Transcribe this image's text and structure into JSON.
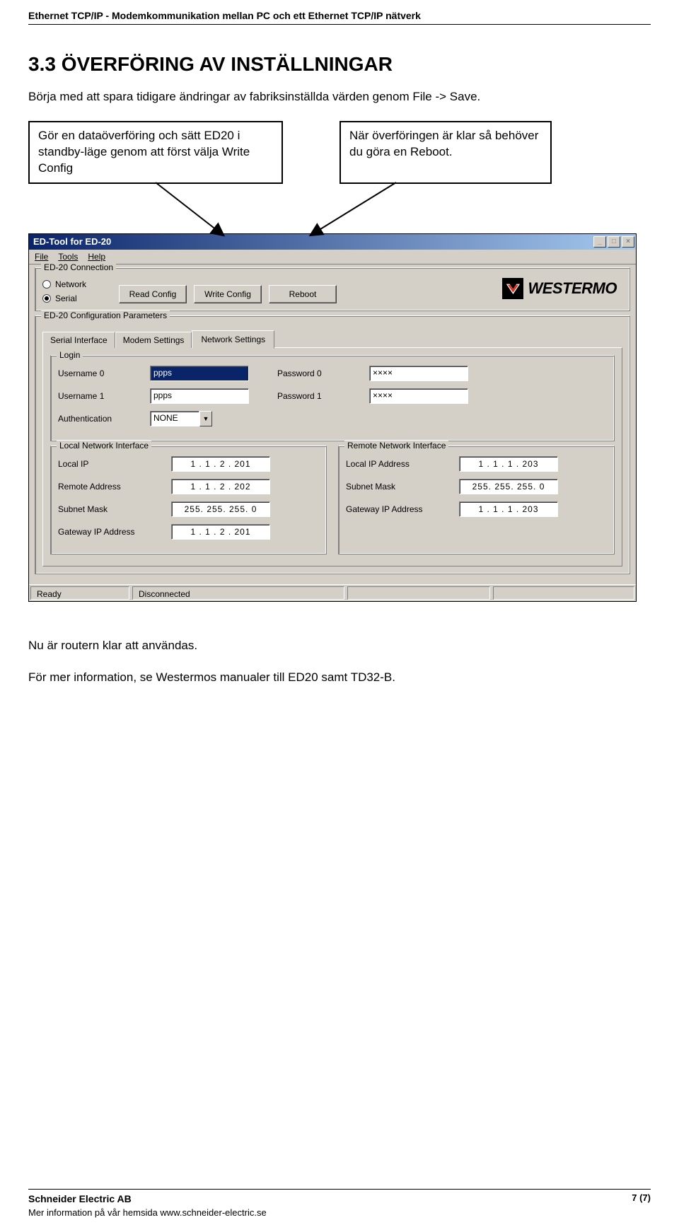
{
  "header": {
    "title": "Ethernet TCP/IP - Modemkommunikation mellan PC och ett Ethernet TCP/IP nätverk"
  },
  "section": {
    "number_title": "3.3   ÖVERFÖRING AV INSTÄLLNINGAR",
    "para1": "Börja med att spara tidigare ändringar av fabriksinställda värden genom File -> Save.",
    "callout_left": "Gör en dataöverföring och sätt ED20 i standby-läge genom att först välja Write Config",
    "callout_right": "När överföringen är klar så behöver du göra en Reboot.",
    "closing1": "Nu är routern klar att användas.",
    "closing2": "För mer information, se Westermos manualer till ED20 samt TD32-B."
  },
  "window": {
    "title": "ED-Tool for ED-20",
    "menubar": [
      "File",
      "Tools",
      "Help"
    ],
    "group_conn": "ED-20 Connection",
    "radios": {
      "network": "Network",
      "serial": "Serial"
    },
    "buttons": {
      "read": "Read Config",
      "write": "Write Config",
      "reboot": "Reboot"
    },
    "logo_text": "WESTERMO",
    "group_params": "ED-20 Configuration Parameters",
    "tabs": [
      "Serial Interface",
      "Modem Settings",
      "Network Settings"
    ],
    "login": {
      "group": "Login",
      "u0_label": "Username 0",
      "u0_value": "ppps",
      "p0_label": "Password 0",
      "p0_value": "××××",
      "u1_label": "Username 1",
      "u1_value": "ppps",
      "p1_label": "Password 1",
      "p1_value": "××××",
      "auth_label": "Authentication",
      "auth_value": "NONE"
    },
    "local_if": {
      "group": "Local Network Interface",
      "rows": [
        {
          "label": "Local IP",
          "value": "1  .  1  .  2  . 201"
        },
        {
          "label": "Remote Address",
          "value": "1  .  1  .  2  . 202"
        },
        {
          "label": "Subnet Mask",
          "value": "255. 255. 255.  0"
        },
        {
          "label": "Gateway IP Address",
          "value": "1  .  1  .  2  . 201"
        }
      ]
    },
    "remote_if": {
      "group": "Remote Network Interface",
      "rows": [
        {
          "label": "Local IP Address",
          "value": "1  .  1  .  1  . 203"
        },
        {
          "label": "Subnet Mask",
          "value": "255. 255. 255.  0"
        },
        {
          "label": "Gateway IP Address",
          "value": "1  .  1  .  1  . 203"
        }
      ]
    },
    "status": {
      "ready": "Ready",
      "conn": "Disconnected"
    }
  },
  "footer": {
    "company": "Schneider Electric AB",
    "info": "Mer information på vår hemsida www.schneider-electric.se",
    "page": "7 (7)"
  }
}
